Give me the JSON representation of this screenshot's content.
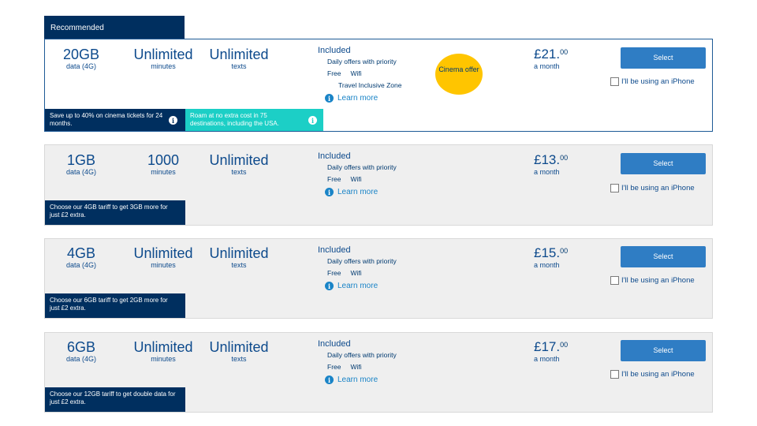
{
  "recommended_label": "Recommended",
  "included_label": "Included",
  "learn_more_label": "Learn more",
  "select_label": "Select",
  "iphone_label": "I'll be using an iPhone",
  "per_month_label": "a month",
  "info_glyph": "i",
  "colors": {
    "navy": "#002f5f",
    "blue_button": "#2f7dc4",
    "teal": "#1ccfc6",
    "yellow": "#ffc500",
    "card_grey": "#efefef"
  },
  "plans": [
    {
      "data_amount": "20GB",
      "data_sub": "data (4G)",
      "minutes_amount": "Unlimited",
      "minutes_sub": "minutes",
      "texts_amount": "Unlimited",
      "texts_sub": "texts",
      "inc_1": "Daily offers with priority",
      "inc_2a": "Free",
      "inc_2b": "Wifi",
      "inc_3": "Travel Inclusive Zone",
      "badge": "Cinema offer",
      "price_pounds": "£21.",
      "price_pence": "00",
      "promo_1": "Save up to 40% on cinema tickets for 24 months.",
      "promo_2": "Roam at no extra cost in 75 destinations, including the USA."
    },
    {
      "data_amount": "1GB",
      "data_sub": "data (4G)",
      "minutes_amount": "1000",
      "minutes_sub": "minutes",
      "texts_amount": "Unlimited",
      "texts_sub": "texts",
      "inc_1": "Daily offers with priority",
      "inc_2a": "Free",
      "inc_2b": "Wifi",
      "price_pounds": "£13.",
      "price_pence": "00",
      "promo_1": "Choose our 4GB tariff to get 3GB more for just £2 extra."
    },
    {
      "data_amount": "4GB",
      "data_sub": "data (4G)",
      "minutes_amount": "Unlimited",
      "minutes_sub": "minutes",
      "texts_amount": "Unlimited",
      "texts_sub": "texts",
      "inc_1": "Daily offers with priority",
      "inc_2a": "Free",
      "inc_2b": "Wifi",
      "price_pounds": "£15.",
      "price_pence": "00",
      "promo_1": "Choose our 6GB tariff to get 2GB more for just £2 extra."
    },
    {
      "data_amount": "6GB",
      "data_sub": "data (4G)",
      "minutes_amount": "Unlimited",
      "minutes_sub": "minutes",
      "texts_amount": "Unlimited",
      "texts_sub": "texts",
      "inc_1": "Daily offers with priority",
      "inc_2a": "Free",
      "inc_2b": "Wifi",
      "price_pounds": "£17.",
      "price_pence": "00",
      "promo_1": "Choose our 12GB tariff to get double data for just £2 extra."
    }
  ]
}
